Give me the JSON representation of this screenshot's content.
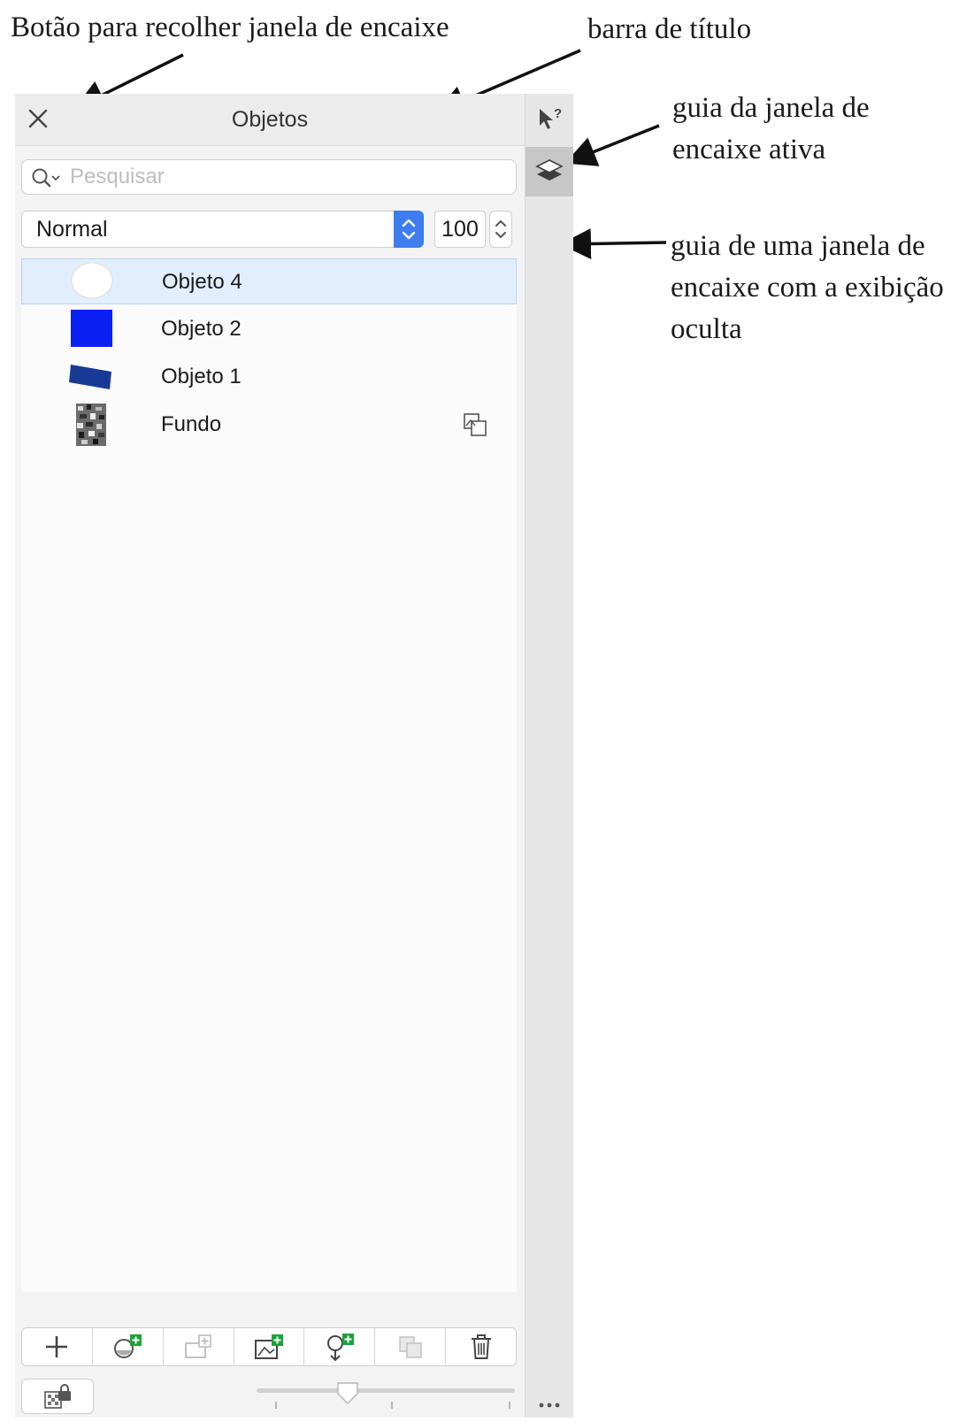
{
  "annotations": {
    "collapse_button": "Botão para recolher janela de encaixe",
    "title_bar": "barra de título",
    "active_tab": "guia da janela de\nencaixe ativa",
    "hidden_tab": "guia de uma janela de\nencaixe com a exibição\noculta"
  },
  "panel": {
    "title": "Objetos",
    "search": {
      "placeholder": "Pesquisar",
      "value": ""
    },
    "blend_mode": "Normal",
    "opacity": "100"
  },
  "objects": [
    {
      "label": "Objeto 4",
      "thumbnail": "white-ellipse",
      "selected": true
    },
    {
      "label": "Objeto 2",
      "thumbnail": "blue-square",
      "color": "#0a1ff2"
    },
    {
      "label": "Objeto 1",
      "thumbnail": "navy-quad",
      "color": "#173a96"
    },
    {
      "label": "Fundo",
      "thumbnail": "photo-texture",
      "badge": "background-icon"
    }
  ],
  "toolbar": [
    "add-icon",
    "new-lens-icon",
    "new-object-icon",
    "new-from-image-icon",
    "new-from-clipboard-icon",
    "combine-icon",
    "delete-icon"
  ],
  "tabs": [
    "hints-icon",
    "objects-layers-icon"
  ],
  "colors": {
    "accent": "#3d7df0",
    "selection": "#e3eefc",
    "add_badge": "#1aa338"
  }
}
